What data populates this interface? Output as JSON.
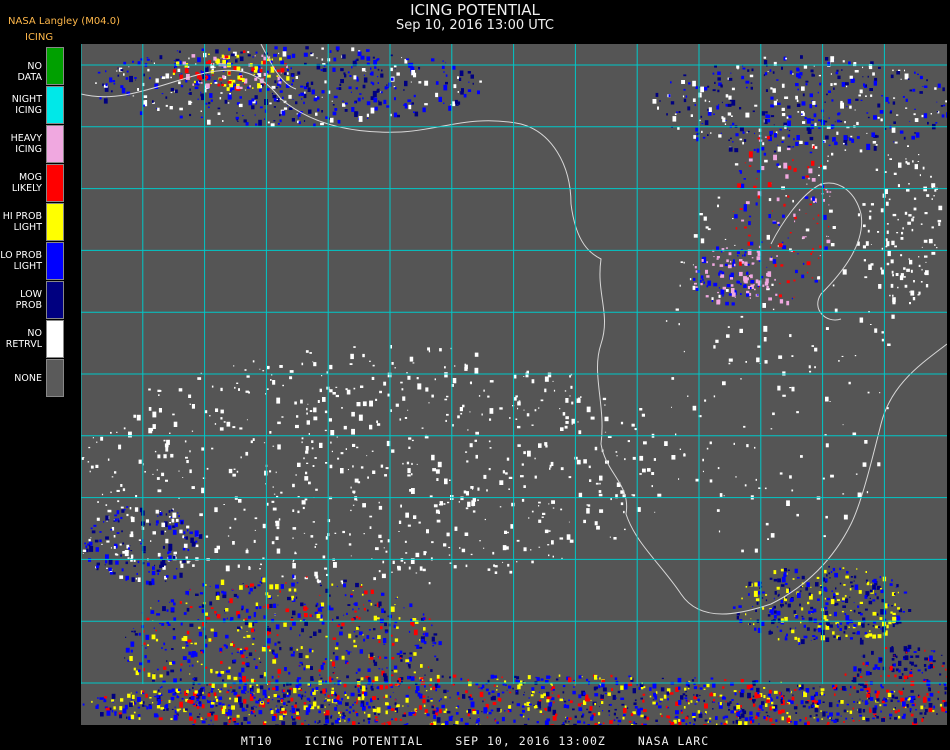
{
  "header": {
    "title": "ICING POTENTIAL",
    "datetime": "Sep 10, 2016 13:00 UTC",
    "producer": "NASA Langley (M04.0)",
    "product": "ICING"
  },
  "legend": [
    {
      "label": "NO DATA",
      "color": "#00a000"
    },
    {
      "label": "NIGHT\nICING",
      "color": "#00e8e8"
    },
    {
      "label": "HEAVY\nICING",
      "color": "#f0a8e0"
    },
    {
      "label": "MOG\nLIKELY",
      "color": "#ff0000"
    },
    {
      "label": "HI PROB\nLIGHT",
      "color": "#ffff00"
    },
    {
      "label": "LO PROB\nLIGHT",
      "color": "#0000ff"
    },
    {
      "label": "LOW\nPROB",
      "color": "#000080"
    },
    {
      "label": "NO\nRETRVL",
      "color": "#ffffff"
    },
    {
      "label": "NONE",
      "color": "#5a5a5a"
    }
  ],
  "colors": {
    "grid": "#00c8c8",
    "background": "#555555",
    "coast": "#d0d0d0"
  },
  "footer": {
    "code": "MT10",
    "product": "ICING POTENTIAL",
    "date": "SEP 10, 2016 13:00Z",
    "source": "NASA LARC"
  }
}
